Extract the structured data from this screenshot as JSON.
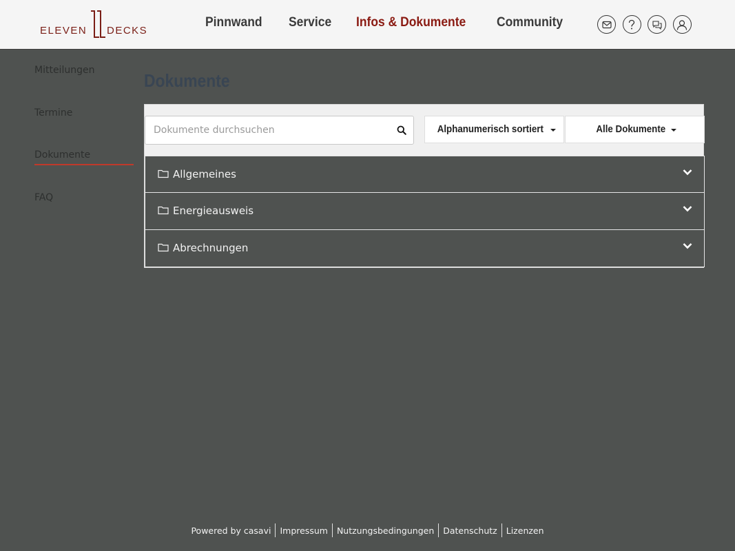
{
  "brand": {
    "word1": "ELEVEN",
    "word2": "DECKS"
  },
  "nav": [
    {
      "label": "Pinnwand"
    },
    {
      "label": "Service"
    },
    {
      "label": "Infos & Dokumente",
      "active": true
    },
    {
      "label": "Community"
    }
  ],
  "header_icons": [
    "mail-icon",
    "help-icon",
    "chat-icon",
    "user-icon"
  ],
  "sidebar": {
    "items": [
      {
        "label": "Mitteilungen"
      },
      {
        "label": "Termine"
      },
      {
        "label": "Dokumente",
        "active": true
      },
      {
        "label": "FAQ"
      }
    ]
  },
  "main": {
    "title": "Dokumente",
    "search": {
      "placeholder": "Dokumente durchsuchen",
      "value": ""
    },
    "sort_dropdown": {
      "label": "Alphanumerisch sortiert"
    },
    "filter_dropdown": {
      "label": "Alle Dokumente"
    },
    "folders": [
      {
        "label": "Allgemeines"
      },
      {
        "label": "Energieausweis"
      },
      {
        "label": "Abrechnungen"
      }
    ]
  },
  "footer": {
    "powered": "Powered by casavi",
    "links": [
      "Impressum",
      "Nutzungsbedingungen",
      "Datenschutz",
      "Lizenzen"
    ]
  },
  "colors": {
    "brand": "#7a1e16",
    "nav_active": "#8a1a12",
    "background": "#4f5250",
    "title": "#394553",
    "sidebar_underline": "#c0392b"
  }
}
